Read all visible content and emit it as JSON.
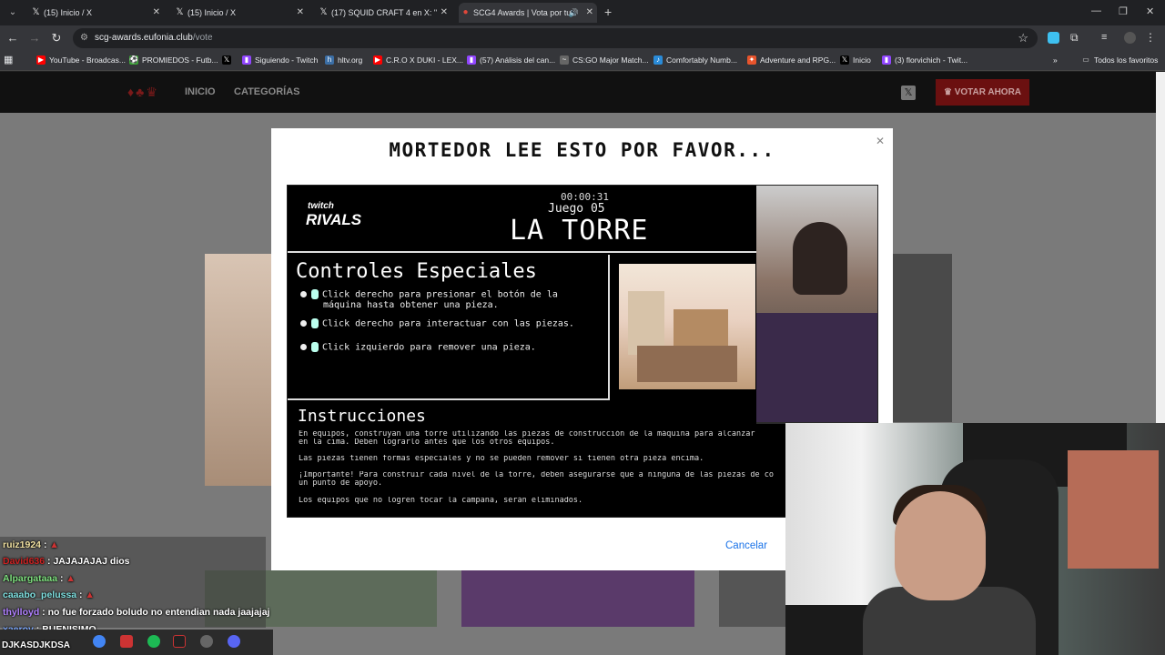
{
  "browser": {
    "tabs": [
      {
        "title": "(15) Inicio / X",
        "icon": "x-logo-icon"
      },
      {
        "title": "(15) Inicio / X",
        "icon": "x-logo-icon"
      },
      {
        "title": "(17) SQUID CRAFT 4 en X: \"",
        "icon": "x-logo-icon"
      },
      {
        "title": "SCG4 Awards | Vota por tus",
        "icon": "site-icon",
        "active": true
      }
    ],
    "url_host": "scg-awards.eufonia.club",
    "url_path": "/vote",
    "bookmarks": [
      {
        "label": "YouTube - Broadcas...",
        "color": "#ff0000"
      },
      {
        "label": "PROMIEDOS - Futb...",
        "color": "#3aa335"
      },
      {
        "label": "",
        "color": "#000000",
        "icon": "x-logo-icon"
      },
      {
        "label": "Siguiendo - Twitch",
        "color": "#9146ff"
      },
      {
        "label": "hltv.org",
        "color": "#3b6ea5"
      },
      {
        "label": "C.R.O X DUKI - LEX...",
        "color": "#ff0000"
      },
      {
        "label": "(57) Análisis del can...",
        "color": "#9146ff"
      },
      {
        "label": "CS:GO Major Match...",
        "color": "#666666"
      },
      {
        "label": "Comfortably Numb...",
        "color": "#2a8bd8"
      },
      {
        "label": "Adventure and RPG...",
        "color": "#e8542c"
      },
      {
        "label": "Inicio",
        "color": "#000000"
      },
      {
        "label": "(3) florvichich - Twit...",
        "color": "#9146ff"
      }
    ],
    "bookmarks_all": "Todos los favoritos"
  },
  "site": {
    "nav": {
      "home": "INICIO",
      "categories": "CATEGORÍAS",
      "vote": "VOTAR AHORA"
    }
  },
  "modal": {
    "title": "MORTEDOR LEE ESTO POR FAVOR...",
    "cancel_label": "Cancelar",
    "game": {
      "brand_top": "twitch",
      "brand_bottom": "RIVALS",
      "timer": "00:00:31",
      "game_number": "Juego 05",
      "game_name": "LA TORRE",
      "controls_title": "Controles Especiales",
      "controls": [
        "Click derecho para presionar el botón de la máquina hasta obtener una pieza.",
        "Click derecho para interactuar con las piezas.",
        "Click izquierdo para remover una pieza."
      ],
      "instructions_title": "Instrucciones",
      "instructions": [
        "En equipos, construyan una torre utilizando las piezas de construcción de la máquina para alcanzar",
        "en la cima. Deben lograrlo antes que los otros equipos.",
        "Las piezas tienen formas especiales y no se pueden remover si tienen otra pieza encima.",
        "¡Importante! Para construir cada nivel de la torre, deben asegurarse que a ninguna de las piezas de co",
        "un punto de apoyo.",
        "Los equipos que no logren tocar la campana, serán eliminados."
      ]
    }
  },
  "chat": [
    {
      "user": "ruiz1924",
      "message": "",
      "color": "#f0e0a0"
    },
    {
      "user": "David636",
      "message": "JAJAJAJAJ dios",
      "color": "#cc2222"
    },
    {
      "user": "Alpargataaa",
      "message": "",
      "color": "#7fe07f"
    },
    {
      "user": "caaabo_pelussa",
      "message": "",
      "color": "#7fe0e0"
    },
    {
      "user": "thylloyd",
      "message": "no fue forzado boludo no entendian nada jaajajaj",
      "color": "#b080ff"
    },
    {
      "user": "xaeroy",
      "message": "BUENISIMO",
      "color": "#7faaff"
    },
    {
      "user": "DJKASDJKDSA",
      "message": "",
      "color": "#ffffff"
    }
  ]
}
